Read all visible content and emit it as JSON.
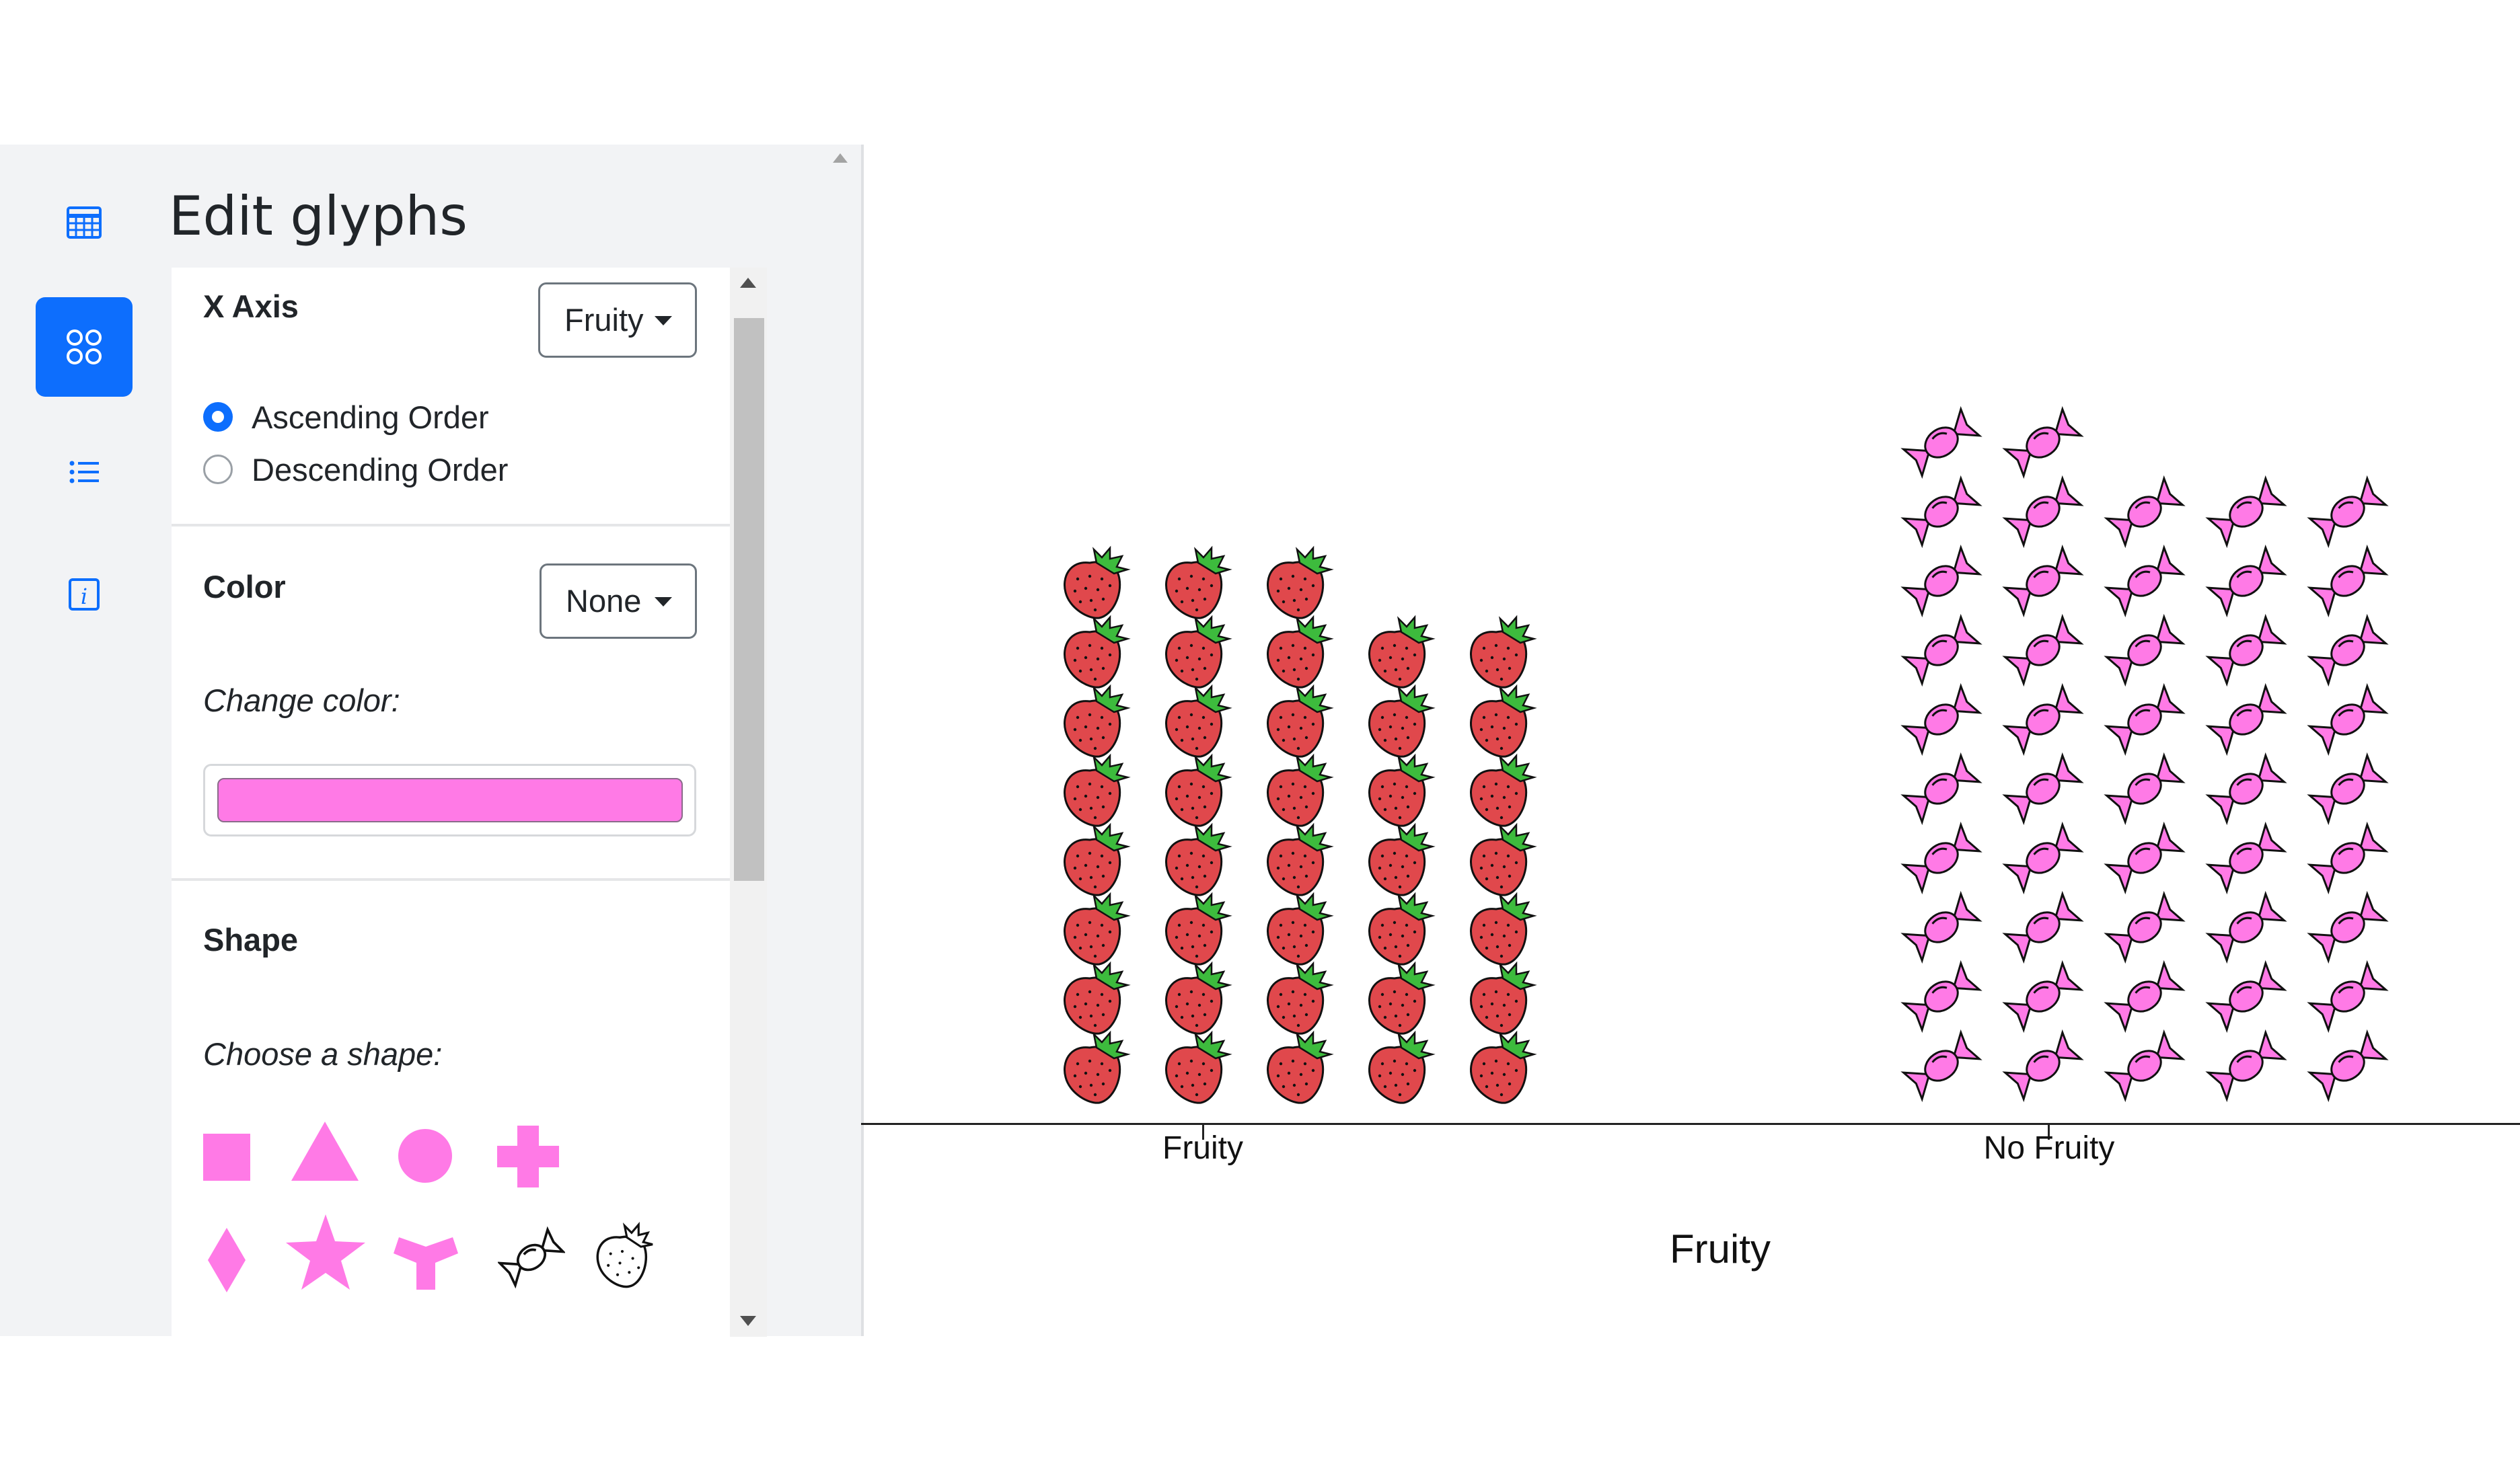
{
  "panel": {
    "title": "Edit glyphs",
    "nav": [
      {
        "name": "table-icon",
        "active": false
      },
      {
        "name": "glyphs-icon",
        "active": true
      },
      {
        "name": "list-icon",
        "active": false
      },
      {
        "name": "info-icon",
        "active": false
      }
    ],
    "x_axis": {
      "label": "X Axis",
      "selected": "Fruity",
      "order_options": [
        "Ascending Order",
        "Descending Order"
      ],
      "order_selected": "Ascending Order"
    },
    "color": {
      "label": "Color",
      "selected": "None",
      "change_label": "Change color:",
      "value": "#ff7ae6"
    },
    "shape": {
      "label": "Shape",
      "choose_label": "Choose a shape:",
      "options": [
        "square",
        "triangle",
        "circle",
        "cross",
        "diamond",
        "star",
        "wye",
        "candy",
        "strawberry"
      ]
    }
  },
  "chart_data": {
    "type": "pictograph",
    "xlabel": "Fruity",
    "categories": [
      "Fruity",
      "No Fruity"
    ],
    "groups": [
      {
        "category": "Fruity",
        "glyph": "strawberry",
        "column_counts": [
          8,
          8,
          8,
          7,
          7
        ],
        "total": 38
      },
      {
        "category": "No Fruity",
        "glyph": "candy",
        "column_counts": [
          10,
          10,
          9,
          9,
          9
        ],
        "total": 47
      }
    ]
  }
}
